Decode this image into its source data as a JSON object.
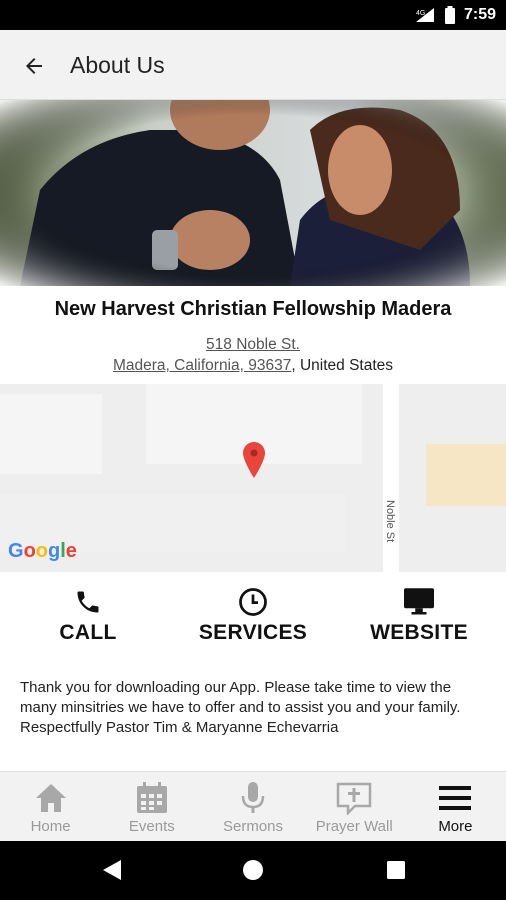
{
  "status_bar": {
    "network": "4G",
    "time": "7:59"
  },
  "app_bar": {
    "title": "About Us",
    "back_icon": "arrow-left-icon"
  },
  "church": {
    "name": "New Harvest Christian Fellowship Madera",
    "address_line1": "518 Noble St.",
    "address_line2": "Madera, California, 93637",
    "country": ", United States"
  },
  "map": {
    "street": "Noble St",
    "logo": "Google"
  },
  "actions": [
    {
      "label": "CALL",
      "icon": "phone-icon"
    },
    {
      "label": "SERVICES",
      "icon": "clock-icon"
    },
    {
      "label": "WEBSITE",
      "icon": "monitor-icon"
    }
  ],
  "description": "Thank you for downloading our App. Please take time to view the many minsitries we have to offer and to  assist you and your family.  Respectfully Pastor Tim & Maryanne Echevarria",
  "bottom_nav": [
    {
      "label": "Home",
      "icon": "house-icon",
      "active": false
    },
    {
      "label": "Events",
      "icon": "calendar-icon",
      "active": false
    },
    {
      "label": "Sermons",
      "icon": "microphone-icon",
      "active": false
    },
    {
      "label": "Prayer Wall",
      "icon": "cross-speech-bubble-icon",
      "active": false
    },
    {
      "label": "More",
      "icon": "hamburger-menu-icon",
      "active": true
    }
  ],
  "colors": {
    "accent_pin": "#e8453c",
    "nav_inactive": "#9a9a9a",
    "app_bar": "#f2f2f2"
  }
}
